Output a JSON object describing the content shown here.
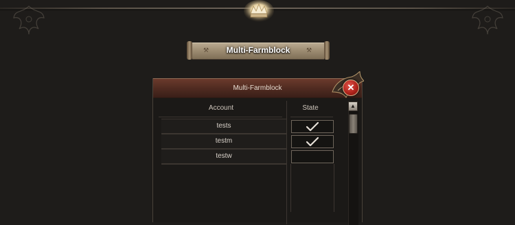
{
  "banner": {
    "title": "Multi-Farmblock"
  },
  "dialog": {
    "title": "Multi-Farmblock",
    "close_symbol": "✕",
    "columns": {
      "account": "Account",
      "state": "State"
    },
    "rows": [
      {
        "account": "tests",
        "checked": true
      },
      {
        "account": "testm",
        "checked": true
      },
      {
        "account": "testw",
        "checked": false
      }
    ]
  },
  "colors": {
    "background": "#1e1c1a",
    "titlebar": "#4e2a20",
    "close_button": "#b0241c",
    "banner": "#9e8d73"
  },
  "icons": {
    "close": "close-icon",
    "check": "check-icon",
    "scroll_up": "chevron-up-icon"
  }
}
